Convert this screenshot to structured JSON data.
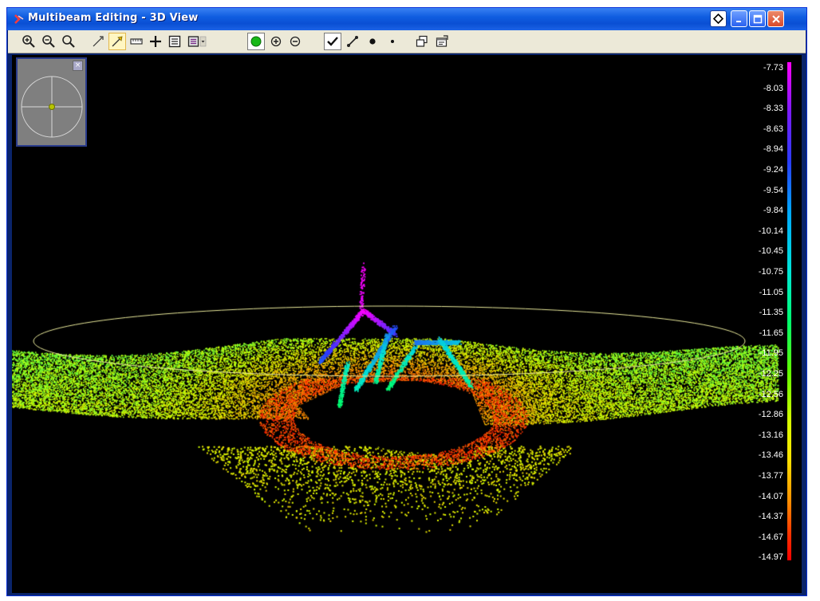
{
  "window": {
    "title": "Multibeam Editing - 3D View",
    "controls": [
      "pin",
      "minimize",
      "maximize",
      "close"
    ]
  },
  "toolbar": {
    "tools": [
      {
        "name": "zoom-in-icon",
        "active": false
      },
      {
        "name": "zoom-out-icon",
        "active": false
      },
      {
        "name": "zoom-extents-icon",
        "active": false
      },
      {
        "name": "select-line-icon",
        "active": false
      },
      {
        "name": "brush-select-icon",
        "active": true
      },
      {
        "name": "ruler-icon",
        "active": false
      },
      {
        "name": "crosshair-icon",
        "active": false
      },
      {
        "name": "list-icon",
        "active": false
      },
      {
        "name": "color-list-dropdown-icon",
        "active": false
      },
      {
        "name": "green-dot-icon",
        "active": false
      },
      {
        "name": "add-point-icon",
        "active": false
      },
      {
        "name": "remove-point-icon",
        "active": false
      },
      {
        "name": "checkmark-icon",
        "active": false
      },
      {
        "name": "connect-line-icon",
        "active": false
      },
      {
        "name": "large-point-icon",
        "active": false
      },
      {
        "name": "small-point-icon",
        "active": false
      },
      {
        "name": "windows-icon",
        "active": false
      },
      {
        "name": "properties-icon",
        "active": false
      }
    ]
  },
  "color_scale": {
    "labels": [
      "-7.73",
      "-8.03",
      "-8.33",
      "-8.63",
      "-8.94",
      "-9.24",
      "-9.54",
      "-9.84",
      "-10.14",
      "-10.45",
      "-10.75",
      "-11.05",
      "-11.35",
      "-11.65",
      "-11.95",
      "-12.25",
      "-12.56",
      "-12.86",
      "-13.16",
      "-13.46",
      "-13.77",
      "-14.07",
      "-14.37",
      "-14.67",
      "-14.97"
    ],
    "colors": [
      "#ff00ff",
      "#2a3cff",
      "#00e5d8",
      "#00ff6e",
      "#d6ff00",
      "#ff9000",
      "#ff0000"
    ]
  },
  "navigator": {
    "close_glyph": "×"
  }
}
